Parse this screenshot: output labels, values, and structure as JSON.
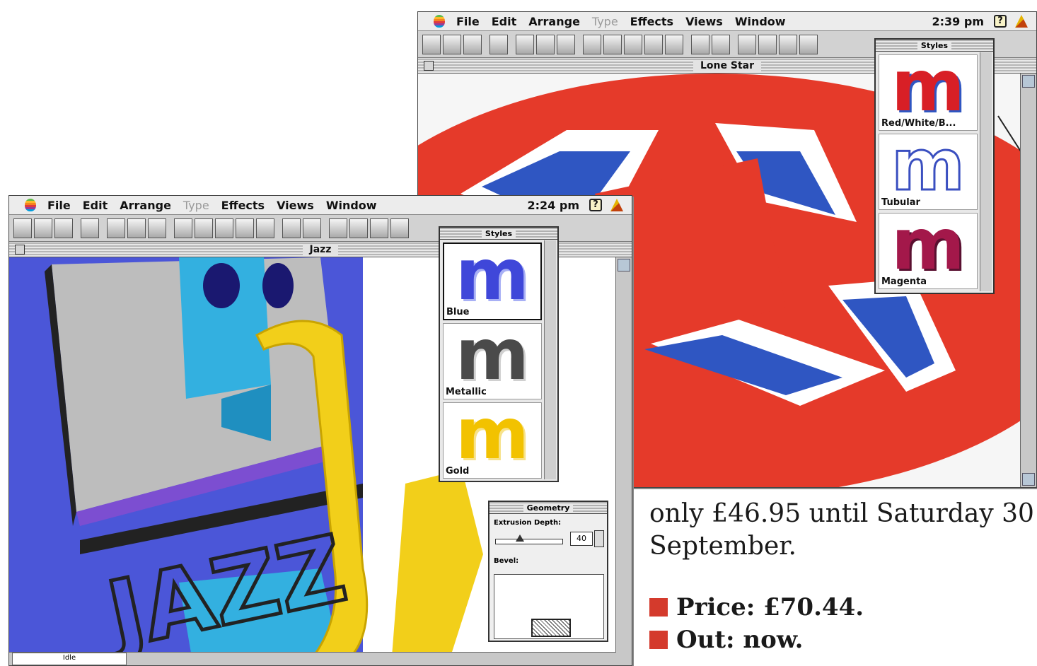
{
  "menu": {
    "items": [
      "File",
      "Edit",
      "Arrange",
      "Type",
      "Effects",
      "Views",
      "Window"
    ],
    "disabled": [
      "Type"
    ]
  },
  "back_window": {
    "clock": "2:39 pm",
    "title": "Lone Star",
    "styles_palette": {
      "title": "Styles",
      "swatches": [
        {
          "name": "Red/White/B...",
          "glyph": "m",
          "color": "#d81f26",
          "outline": "#ffffff"
        },
        {
          "name": "Tubular",
          "glyph": "m",
          "color": "#ffffff",
          "outline": "#3a4fc0"
        },
        {
          "name": "Magenta",
          "glyph": "m",
          "color": "#a3184a",
          "outline": "#5a1030"
        }
      ]
    }
  },
  "front_window": {
    "clock": "2:24 pm",
    "title": "Jazz",
    "styles_palette": {
      "title": "Styles",
      "swatches": [
        {
          "name": "Blue",
          "glyph": "m",
          "color": "#3f47d9",
          "outline": "#a8b0f5",
          "selected": true
        },
        {
          "name": "Metallic",
          "glyph": "m",
          "color": "#4a4a4a",
          "outline": "#d0d0d0"
        },
        {
          "name": "Gold",
          "glyph": "m",
          "color": "#f2c200",
          "outline": "#f7e28a"
        }
      ]
    },
    "geometry_palette": {
      "title": "Geometry",
      "extrusion_label": "Extrusion Depth:",
      "extrusion_value": "40",
      "bevel_label": "Bevel:"
    },
    "status_field": "Idle",
    "artwork_text": "JAZZ"
  },
  "article": {
    "promo": "only £46.95 until Saturday 30 September.",
    "price": "Price: £70.44.",
    "out": "Out: now."
  },
  "colors": {
    "bullet": "#d43a2c",
    "lone_star_red": "#e53a2a",
    "lone_star_blue": "#2f56c2",
    "jazz_blue": "#4b56d8",
    "jazz_cyan": "#33b0e0",
    "jazz_gold": "#f2cf1a",
    "jazz_gray": "#bdbdbd"
  }
}
